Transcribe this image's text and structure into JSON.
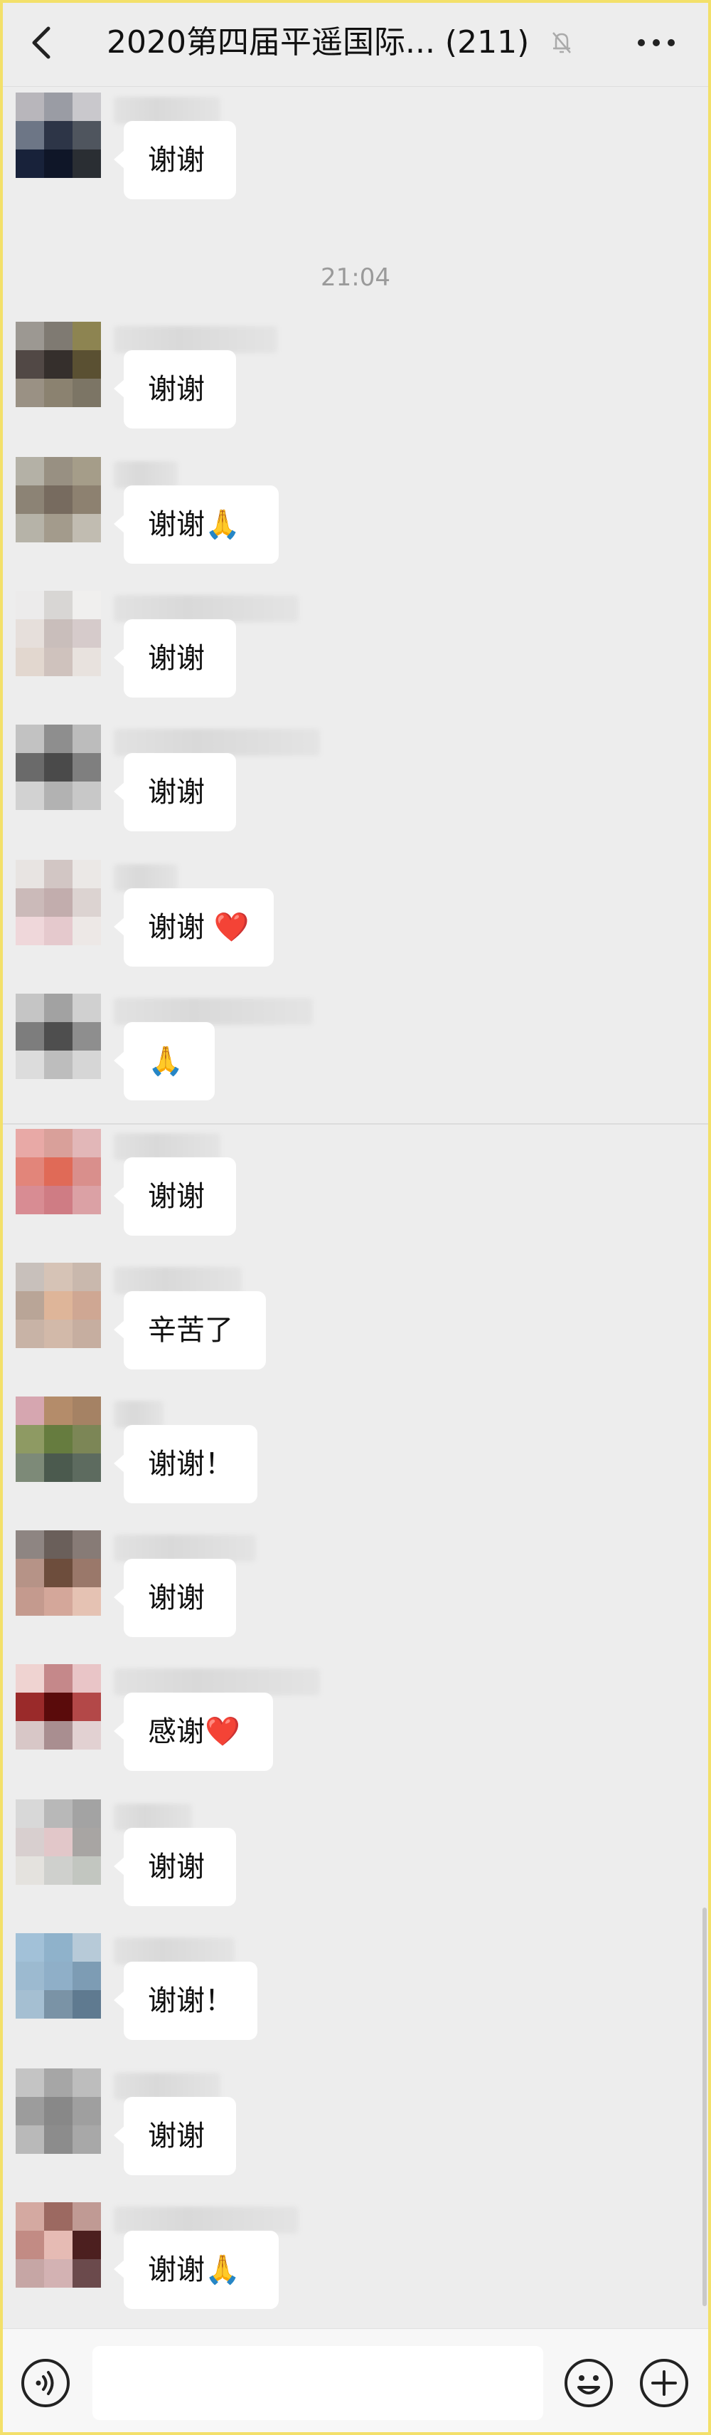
{
  "header": {
    "title": "2020第四届平遥国际...   (211)",
    "back_icon": "chevron-left-icon",
    "mute_icon": "bell-muted-icon",
    "more_icon": "more-dots-icon"
  },
  "chat": {
    "timestamp": "21:04",
    "messages": [
      {
        "text": "谢谢"
      },
      {
        "text": "谢谢"
      },
      {
        "text": "谢谢🙏"
      },
      {
        "text": "谢谢"
      },
      {
        "text": "谢谢"
      },
      {
        "text": "谢谢 ❤️"
      },
      {
        "text": "🙏"
      },
      {
        "text": "谢谢"
      },
      {
        "text": "辛苦了"
      },
      {
        "text": "谢谢！"
      },
      {
        "text": "谢谢"
      },
      {
        "text": "感谢❤️"
      },
      {
        "text": "谢谢"
      },
      {
        "text": "谢谢！"
      },
      {
        "text": "谢谢"
      },
      {
        "text": "谢谢🙏"
      }
    ]
  },
  "input_bar": {
    "placeholder": "",
    "voice_icon": "voice-icon",
    "emoji_icon": "emoji-icon",
    "plus_icon": "plus-icon"
  },
  "colors": {
    "background": "#ededed",
    "bubble": "#ffffff",
    "timestamp": "#9a9a9a"
  }
}
